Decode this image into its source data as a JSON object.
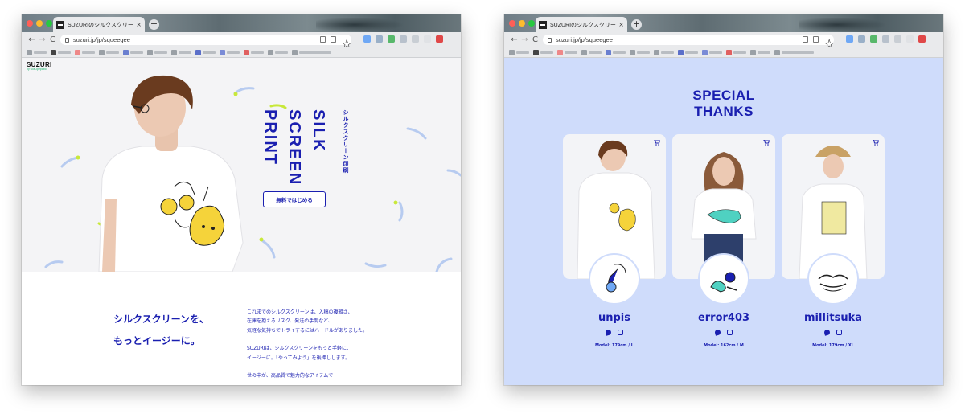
{
  "browser": {
    "tab_title": "SUZURIのシルクスクリーン ∞",
    "tab_close": "×",
    "new_tab": "+",
    "url": "suzuri.jp/jp/squeegee",
    "nav_back": "←",
    "nav_forward": "→",
    "nav_reload": "C"
  },
  "left_page": {
    "logo": "SUZURI",
    "logo_sub": "by GMOpepabo",
    "hero_title": [
      "SILK",
      "SCREEN",
      "PRINT"
    ],
    "hero_subtitle_jp": "シルクスクリーン印刷",
    "cta_label": "無料ではじめる",
    "heading_lines": [
      "シルクスクリーンを、",
      "もっとイージーに。"
    ],
    "body_para1": [
      "これまでのシルクスクリーンは、入稿の複雑さ、",
      "在庫を抱えるリスク、発送の手間など、",
      "気軽な気持ちでトライするにはハードルがありました。"
    ],
    "body_para2": [
      "SUZURIは、シルクスクリーンをもっと手軽に、",
      "イージーに。「やってみよう」を後押しします。"
    ],
    "body_para3": "世の中が、高品質で魅力的なアイテムで"
  },
  "right_page": {
    "title_lines": [
      "SPECIAL",
      "THANKS"
    ],
    "models": [
      {
        "name": "unpis",
        "info": "Model: 179cm / L"
      },
      {
        "name": "error403",
        "info": "Model: 162cm / M"
      },
      {
        "name": "millitsuka",
        "info": "Model: 179cm / XL"
      }
    ]
  },
  "colors": {
    "brand_blue": "#1a1fb0",
    "right_bg": "#cfdcfb",
    "hero_bg": "#f4f4f6",
    "print_yellow": "#f5d33a"
  },
  "icons": [
    "back-arrow-icon",
    "forward-arrow-icon",
    "reload-icon",
    "lock-icon",
    "cart-icon",
    "twitter-icon",
    "instagram-icon"
  ]
}
